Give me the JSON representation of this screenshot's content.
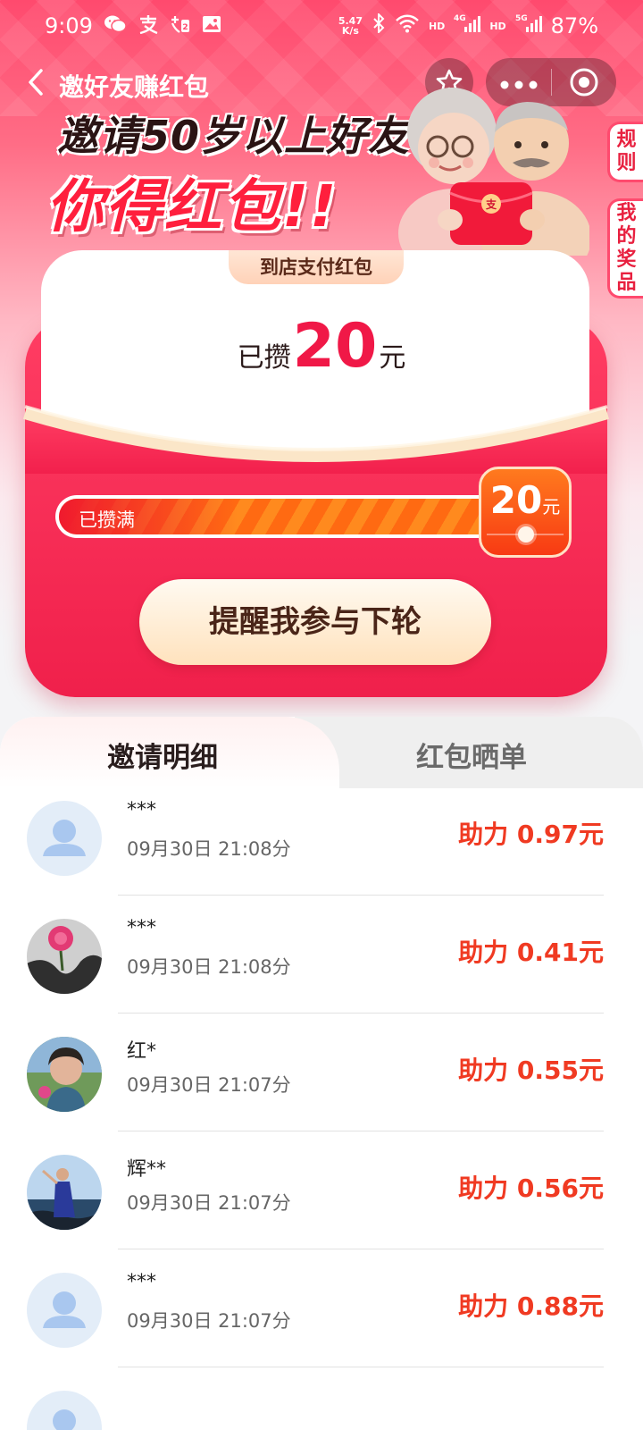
{
  "status_bar": {
    "time": "9:09",
    "left_icons": [
      "wechat-icon",
      "alipay-icon",
      "alipay-notification-icon",
      "gallery-icon"
    ],
    "net_speed_value": "5.47",
    "net_speed_unit": "K/s",
    "hd1": "HD",
    "signal1": "4G",
    "hd2": "HD",
    "signal2": "5G",
    "battery": "87%"
  },
  "nav": {
    "title": "邀好友赚红包"
  },
  "headline": {
    "line1": "邀请50岁以上好友",
    "line2": "你得红包!!"
  },
  "side_tabs": {
    "rules": [
      "规",
      "则"
    ],
    "prizes": [
      "我",
      "的",
      "奖",
      "品"
    ]
  },
  "card": {
    "badge": "到店支付红包",
    "saved_prefix": "已攒",
    "saved_amount": "20",
    "saved_unit": "元",
    "progress_label": "已攒满",
    "progress_fraction": 1.0,
    "goal_value": "20",
    "goal_unit": "元",
    "remind_button": "提醒我参与下轮"
  },
  "tabs": {
    "invite_details": "邀请明细",
    "redpacket_share": "红包晒单"
  },
  "invites": [
    {
      "name": "***",
      "time": "09月30日 21:08分",
      "amount": "助力 0.97元",
      "avatar": "default"
    },
    {
      "name": "***",
      "time": "09月30日 21:08分",
      "amount": "助力 0.41元",
      "avatar": "flower"
    },
    {
      "name": "红*",
      "time": "09月30日 21:07分",
      "amount": "助力 0.55元",
      "avatar": "woman"
    },
    {
      "name": "辉**",
      "time": "09月30日 21:07分",
      "amount": "助力 0.56元",
      "avatar": "seaside"
    },
    {
      "name": "***",
      "time": "09月30日 21:07分",
      "amount": "助力 0.88元",
      "avatar": "default"
    }
  ],
  "colors": {
    "brand_red": "#f01847",
    "amount_orange": "#f03a22",
    "button_text": "#4a2518"
  }
}
